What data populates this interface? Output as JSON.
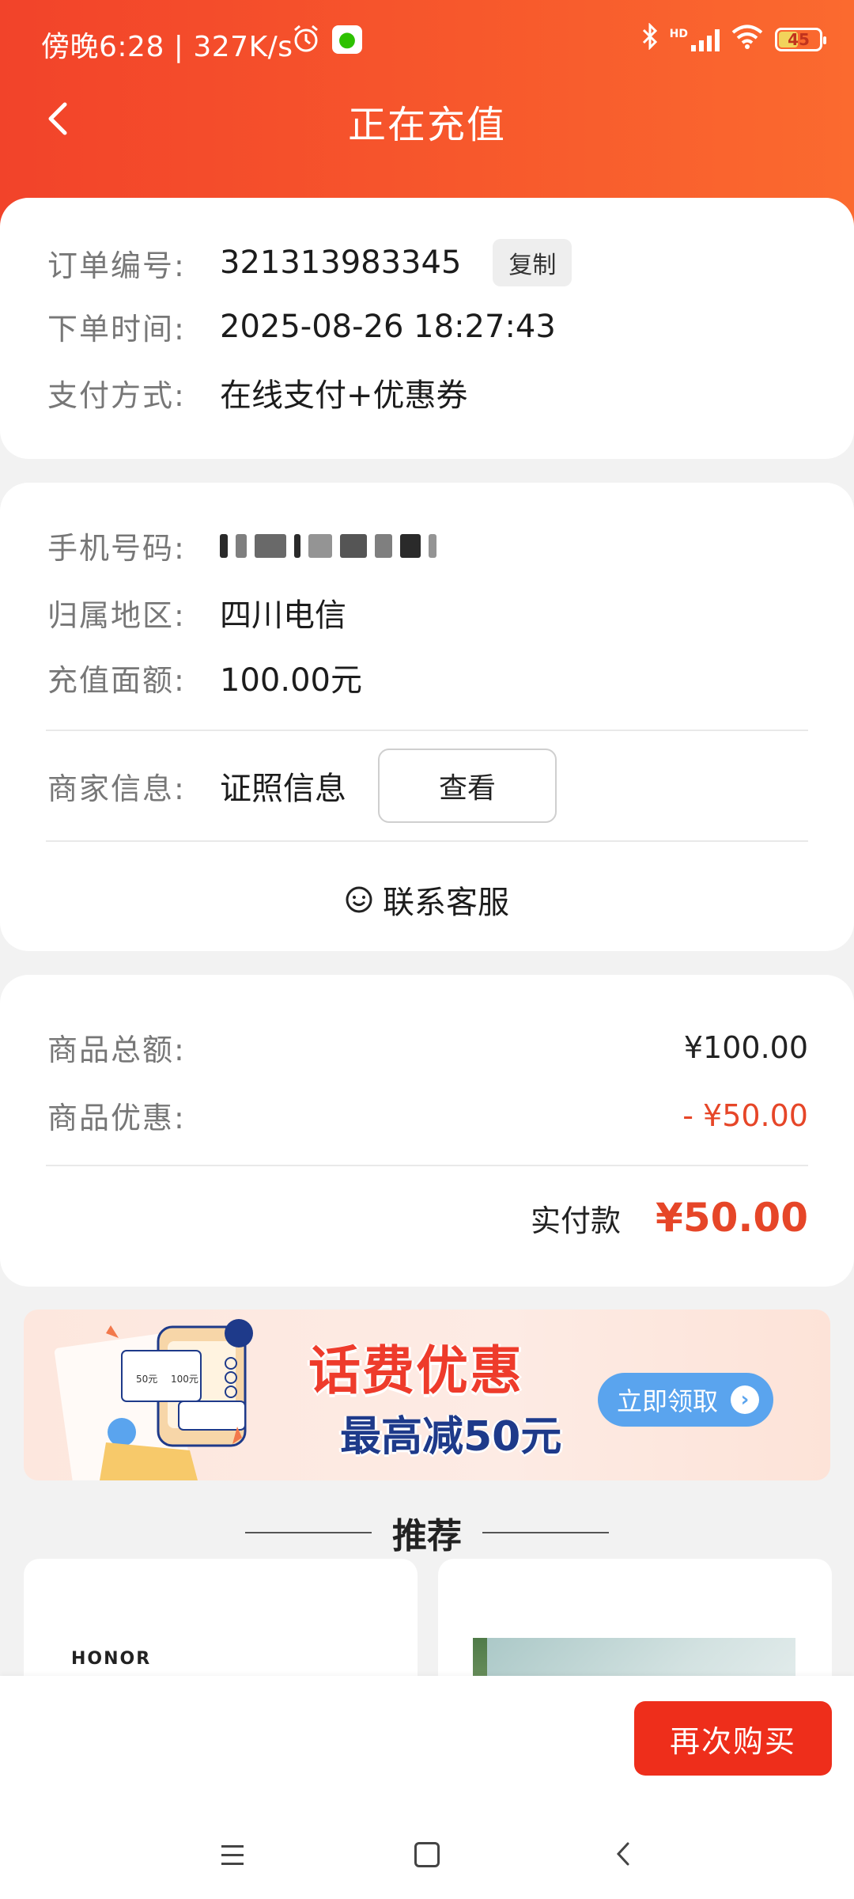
{
  "status_bar": {
    "time": "傍晚6:28 | 327K/s",
    "battery": "45",
    "network_label": "HD"
  },
  "nav": {
    "title": "正在充值"
  },
  "order": {
    "order_no_label": "订单编号:",
    "order_no": "321313983345",
    "copy_label": "复制",
    "time_label": "下单时间:",
    "time": "2025-08-26 18:27:43",
    "pay_method_label": "支付方式:",
    "pay_method": "在线支付+优惠券"
  },
  "recharge": {
    "phone_label": "手机号码:",
    "region_label": "归属地区:",
    "region": "四川电信",
    "amount_label": "充值面额:",
    "amount": "100.00元",
    "merchant_label": "商家信息:",
    "merchant_value": "证照信息",
    "view_label": "查看",
    "service_label": "联系客服"
  },
  "price": {
    "total_label": "商品总额:",
    "total": "¥100.00",
    "discount_label": "商品优惠:",
    "discount": "- ¥50.00",
    "paid_label": "实付款",
    "paid": "¥50.00"
  },
  "banner": {
    "title": "话费优惠",
    "subtitle": "最高减50元",
    "button": "立即领取",
    "coupon_a": "50元",
    "coupon_b": "100元"
  },
  "recommend": {
    "title": "推荐",
    "brand": "HONOR"
  },
  "bottom": {
    "rebuy_label": "再次购买"
  },
  "colors": {
    "header_start": "#f2432a",
    "header_end": "#fb6a2f",
    "accent_red": "#e64628",
    "button_red": "#ee2e1b",
    "banner_blue": "#5aa4ee"
  }
}
